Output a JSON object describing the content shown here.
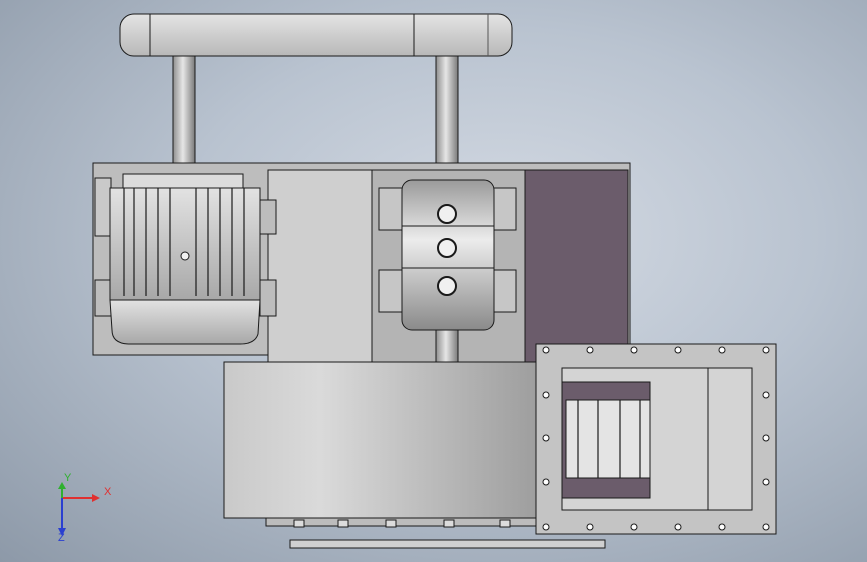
{
  "viewport": {
    "background_colors": [
      "#d4dae3",
      "#b9c3d0",
      "#8d99a8"
    ]
  },
  "model": {
    "parts": [
      "belt-housing",
      "pulley-shaft-left",
      "pulley-shaft-right",
      "mounting-frame",
      "electric-motor",
      "bearing-block-assembly",
      "rotor-housing",
      "inlet-flange",
      "outlet-base"
    ],
    "colors": {
      "metal_light": "#dedede",
      "metal_mid": "#bdbdbd",
      "metal_dark": "#8a8a8a",
      "panel_purple": "#6b5c6b",
      "outline": "#1a1a1a"
    }
  },
  "triad": {
    "x_label": "X",
    "y_label": "Y",
    "z_label": "Z",
    "x_color": "#e03030",
    "y_color": "#2fb02f",
    "z_color": "#2a3fd0"
  }
}
